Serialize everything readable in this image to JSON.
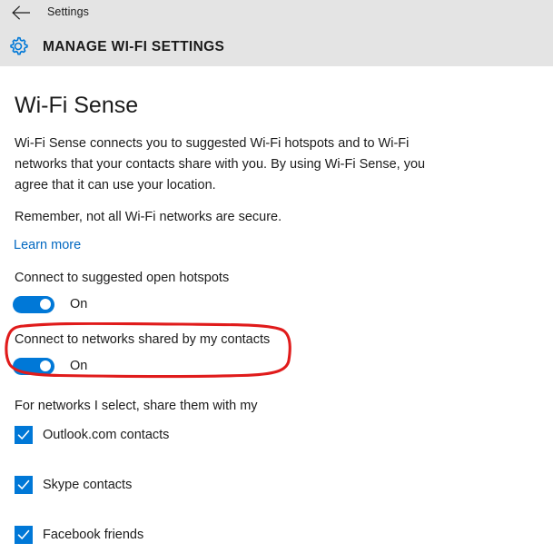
{
  "chrome": {
    "back_icon": "back-arrow-icon",
    "app_title": "Settings",
    "header_icon": "gear-icon",
    "header_title": "MANAGE WI-FI SETTINGS",
    "band_color": "#e4e4e4"
  },
  "page": {
    "section_title": "Wi-Fi Sense",
    "body_paragraph": "Wi-Fi Sense connects you to suggested Wi-Fi hotspots and to Wi-Fi networks that your contacts share with you. By using Wi-Fi Sense, you agree that it can use your location.",
    "note_paragraph": "Remember, not all Wi-Fi networks are secure.",
    "learn_more_link": "Learn more",
    "link_color": "#0067c0"
  },
  "toggles": [
    {
      "label": "Connect to suggested open hotspots",
      "state": "On",
      "checked": true,
      "accent": "#0078d7"
    },
    {
      "label": "Connect to networks shared by my contacts",
      "state": "On",
      "checked": true,
      "accent": "#0078d7"
    }
  ],
  "annotation": {
    "type": "hand-drawn-oval",
    "color": "#e01b1b",
    "target": "Connect to networks shared by my contacts"
  },
  "share_group": {
    "label": "For networks I select, share them with my",
    "accent": "#0078d7",
    "items": [
      {
        "label": "Outlook.com contacts",
        "checked": true
      },
      {
        "label": "Skype contacts",
        "checked": true
      },
      {
        "label": "Facebook friends",
        "checked": true
      }
    ]
  }
}
